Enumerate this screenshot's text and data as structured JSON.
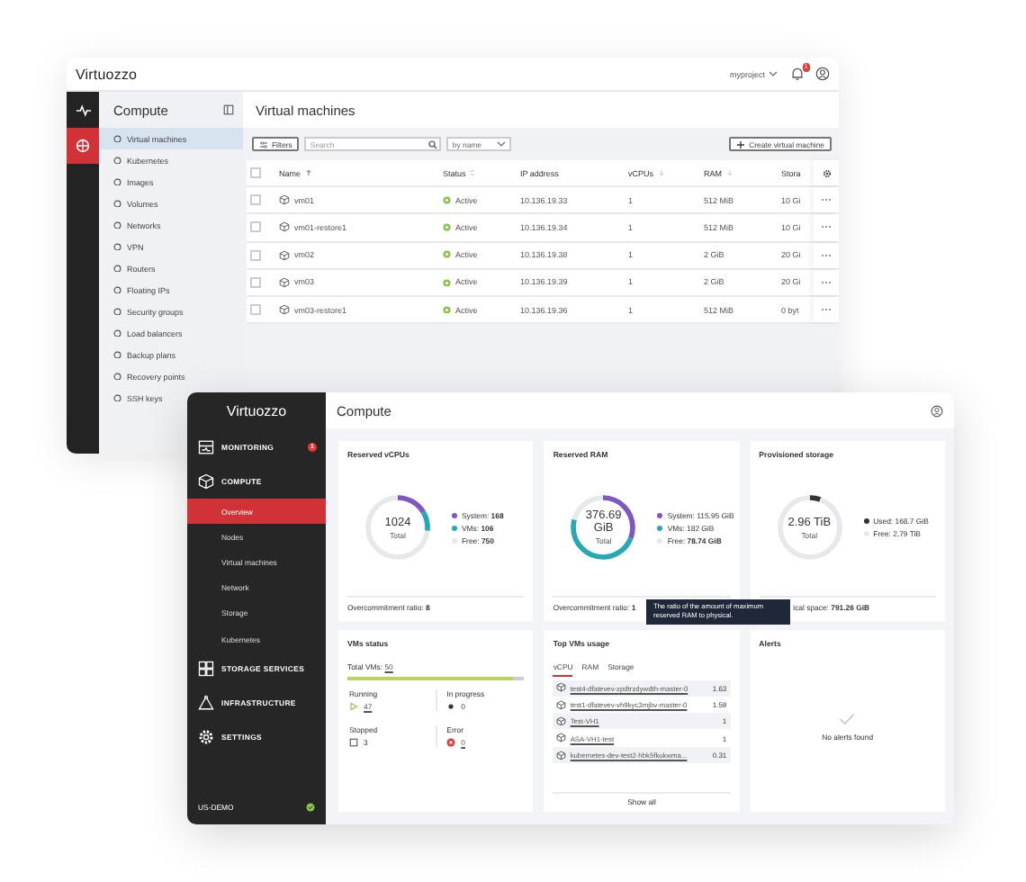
{
  "back_window": {
    "logo": "Virtuozzo",
    "project": "myproject",
    "notification_badge": "1",
    "rail": [
      {
        "kind": "monitoring",
        "selected": false
      },
      {
        "kind": "compute",
        "selected": true
      }
    ],
    "sidebar": {
      "title": "Compute",
      "items": [
        {
          "label": "Virtual machines",
          "selected": true
        },
        {
          "label": "Kubernetes",
          "selected": false
        },
        {
          "label": "Images",
          "selected": false
        },
        {
          "label": "Volumes",
          "selected": false
        },
        {
          "label": "Networks",
          "selected": false
        },
        {
          "label": "VPN",
          "selected": false
        },
        {
          "label": "Routers",
          "selected": false
        },
        {
          "label": "Floating IPs",
          "selected": false
        },
        {
          "label": "Security groups",
          "selected": false
        },
        {
          "label": "Load balancers",
          "selected": false
        },
        {
          "label": "Backup plans",
          "selected": false
        },
        {
          "label": "Recovery points",
          "selected": false
        },
        {
          "label": "SSH keys",
          "selected": false
        }
      ]
    },
    "page_title": "Virtual machines",
    "toolbar": {
      "filters": "Filters",
      "search_placeholder": "Search",
      "sort": "by name",
      "create": "Create virtual machine"
    },
    "table": {
      "all_checked": false,
      "columns": [
        {
          "label": "Name",
          "kind": "sorted"
        },
        {
          "label": "Status",
          "kind": "sortable"
        },
        {
          "label": "IP address",
          "kind": "plain"
        },
        {
          "label": "vCPUs",
          "kind": "descending"
        },
        {
          "label": "RAM",
          "kind": "descending"
        },
        {
          "label": "Stora",
          "kind": "plain"
        }
      ],
      "rows": [
        {
          "checked": false,
          "name": "vm01",
          "status": "Active",
          "ip": "10.136.19.33",
          "vcpus": "1",
          "ram": "512 MiB",
          "storage": "10 Gi"
        },
        {
          "checked": false,
          "name": "vm01-restore1",
          "status": "Active",
          "ip": "10.136.19.34",
          "vcpus": "1",
          "ram": "512 MiB",
          "storage": "10 Gi"
        },
        {
          "checked": false,
          "name": "vm02",
          "status": "Active",
          "ip": "10.136.19.38",
          "vcpus": "1",
          "ram": "2 GiB",
          "storage": "20 Gi"
        },
        {
          "checked": false,
          "name": "vm03",
          "status": "Active",
          "ip": "10.136.19.39",
          "vcpus": "1",
          "ram": "2 GiB",
          "storage": "20 Gi"
        },
        {
          "checked": false,
          "name": "vm03-restore1",
          "status": "Active",
          "ip": "10.136.19.36",
          "vcpus": "1",
          "ram": "512 MiB",
          "storage": "0 byt"
        }
      ]
    }
  },
  "front_window": {
    "logo": "Virtuozzo",
    "nav": [
      {
        "kind": "monitoring",
        "label": "MONITORING",
        "badge": "1"
      },
      {
        "kind": "compute",
        "label": "COMPUTE",
        "children": [
          {
            "label": "Overview",
            "selected": true
          },
          {
            "label": "Nodes",
            "selected": false
          },
          {
            "label": "Virtual machines",
            "selected": false
          },
          {
            "label": "Network",
            "selected": false
          },
          {
            "label": "Storage",
            "selected": false
          },
          {
            "label": "Kubernetes",
            "selected": false
          }
        ]
      },
      {
        "kind": "storage",
        "label": "STORAGE SERVICES"
      },
      {
        "kind": "infrastructure",
        "label": "INFRASTRUCTURE"
      },
      {
        "kind": "settings",
        "label": "SETTINGS"
      }
    ],
    "site": {
      "label": "US-DEMO",
      "online": true
    },
    "title": "Compute",
    "donut_cards": [
      {
        "title": "Reserved vCPUs",
        "total": [
          "1024"
        ],
        "total_label": "Total",
        "legend": [
          {
            "text": "System: **168**",
            "color": "#7e57c2",
            "level": 0.164
          },
          {
            "text": "VMs: **106**",
            "color": "#26a9b4",
            "level": 0.104
          },
          {
            "text": "Free: **750**",
            "color": "#e6e8ec",
            "level": 0.732
          }
        ],
        "footer": "Overcommitment ratio: **8**"
      },
      {
        "title": "Reserved RAM",
        "total": [
          "376.69",
          "GiB"
        ],
        "total_label": "Total",
        "legend": [
          {
            "text": "System: 115.95 GiB",
            "color": "#7e57c2",
            "level": 0.308
          },
          {
            "text": "VMs: 182 GiB",
            "color": "#26a9b4",
            "level": 0.483
          },
          {
            "text": "Free: **78.74 GiB**",
            "color": "#e6e8ec",
            "level": 0.209
          }
        ],
        "footer": "Overcommitment ratio: **1**"
      },
      {
        "title": "Provisioned storage",
        "total": [
          "2.96 TiB"
        ],
        "total_label": "Total",
        "legend": [
          {
            "text": "Used: 168.7 GiB",
            "color": "#333333",
            "level": 0.056
          },
          {
            "text": "Free: 2.79 TiB",
            "color": "#e6e8ec",
            "level": 0.944
          }
        ],
        "footer": "ical space: **791.26 GiB**"
      }
    ],
    "tooltip": "The ratio of the amount of maximum reserved RAM to physical.",
    "vms_status": {
      "title": "VMs status",
      "total_label": "Total VMs:",
      "total": "50",
      "level": 0.94,
      "states": [
        {
          "kind": "running",
          "label": "Running",
          "count": "47",
          "link": true
        },
        {
          "kind": "progress",
          "label": "In progress",
          "count": "0",
          "link": false
        },
        {
          "kind": "stopped",
          "label": "Stopped",
          "count": "3",
          "link": false
        },
        {
          "kind": "error",
          "label": "Error",
          "count": "0",
          "link": true
        }
      ]
    },
    "top_vms": {
      "title": "Top VMs usage",
      "tabs": [
        {
          "label": "vCPU",
          "selected": true
        },
        {
          "label": "RAM",
          "selected": false
        },
        {
          "label": "Storage",
          "selected": false
        }
      ],
      "rows": [
        {
          "name": "test4-dfatevev-zpdtrzdywdth-master-0",
          "value": "1.63"
        },
        {
          "name": "test1-dfatevev-vh9kyc3mjbv-master-0",
          "value": "1.59"
        },
        {
          "name": "Test-VH1",
          "value": "1"
        },
        {
          "name": "ASA-VH1-test",
          "value": "1"
        },
        {
          "name": "kubernetes-dev-test2-hbk5fkukwma...",
          "value": "0.31"
        }
      ],
      "show_all": "Show all"
    },
    "alerts": {
      "title": "Alerts",
      "empty": "No alerts found"
    }
  }
}
